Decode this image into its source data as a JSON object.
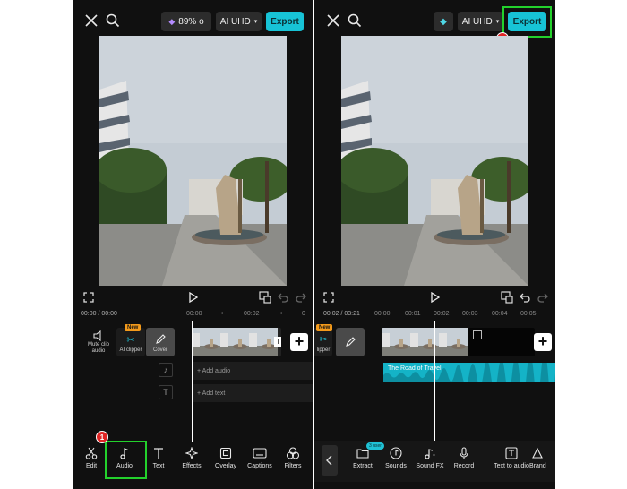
{
  "colors": {
    "accent": "#17c3d6",
    "highlight": "#23d12c",
    "badge": "#e02424",
    "new_tag": "#f39a1b",
    "background": "#101010"
  },
  "left": {
    "storage_pill": "89% o",
    "quality": "AI UHD",
    "export": "Export",
    "timecode": "00:00 / 00:00",
    "ruler": [
      "00:00",
      "00:02"
    ],
    "mute_label": "Mute clip audio",
    "ai_clipper_label": "AI clipper",
    "new_tag": "New",
    "cover_label": "Cover",
    "add_audio": "+ Add audio",
    "add_text": "+ Add text",
    "clip_duration": "I",
    "plus": "+",
    "tools": [
      "Edit",
      "Audio",
      "Text",
      "Effects",
      "Overlay",
      "Captions",
      "Filters"
    ],
    "step_badge": "1"
  },
  "right": {
    "quality": "AI UHD",
    "export": "Export",
    "timecode": "00:02 / 03:21",
    "ruler": [
      "00:00",
      "00:01",
      "00:02",
      "00:03",
      "00:04",
      "00:05"
    ],
    "clipper_label": "lipper",
    "new_tag": "New",
    "audio_title": "The Road of Travel",
    "plus": "+",
    "tools": [
      "Extract",
      "Sounds",
      "Sound FX",
      "Record",
      "Text to audio",
      "Brand"
    ],
    "users_tag": "3 user",
    "step_badge": "2"
  }
}
